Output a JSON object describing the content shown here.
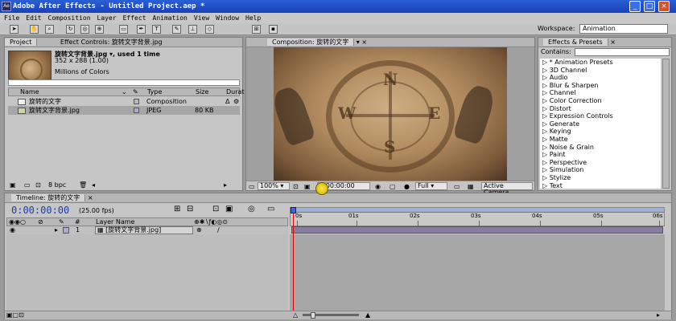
{
  "window": {
    "title": "Adobe After Effects - Untitled Project.aep *"
  },
  "menu": [
    "File",
    "Edit",
    "Composition",
    "Layer",
    "Effect",
    "Animation",
    "View",
    "Window",
    "Help"
  ],
  "toolbar": {
    "workspace_label": "Workspace:",
    "workspace_value": "Animation"
  },
  "project_panel": {
    "tabs": [
      "Project",
      "Effect Controls: 旋转文字背景.jpg"
    ],
    "selected_name": "旋转文字背景.jpg ▾, used 1 time",
    "dimensions": "352 x 288 (1.00)",
    "colors": "Millions of Colors",
    "columns": [
      "Name",
      "Type",
      "Size",
      "Durat"
    ],
    "rows": [
      {
        "name": "旋转的文字",
        "type": "Composition",
        "size": "",
        "dur": "Δ"
      },
      {
        "name": "旋转文字背景.jpg",
        "type": "JPEG",
        "size": "80 KB",
        "dur": ""
      }
    ],
    "bpc": "8 bpc"
  },
  "comp_panel": {
    "tab": "Composition: 旋转的文字",
    "zoom": "100%",
    "timecode": "0:00:00:00",
    "resolution": "Full",
    "camera": "Active Camera",
    "compass_letters": {
      "n": "N",
      "s": "S",
      "e": "E",
      "w": "W"
    }
  },
  "effects_panel": {
    "tab": "Effects & Presets",
    "contains_label": "Contains:",
    "items": [
      "▷ * Animation Presets",
      "▷ 3D Channel",
      "▷ Audio",
      "▷ Blur & Sharpen",
      "▷ Channel",
      "▷ Color Correction",
      "▷ Distort",
      "▷ Expression Controls",
      "▷ Generate",
      "▷ Keying",
      "▷ Matte",
      "▷ Noise & Grain",
      "▷ Paint",
      "▷ Perspective",
      "▷ Simulation",
      "▷ Stylize",
      "▷ Text"
    ]
  },
  "timeline": {
    "tab": "Timeline: 旋转的文字",
    "timecode": "0:00:00:00",
    "fps": "(25.00 fps)",
    "col_num": "#",
    "col_layer": "Layer Name",
    "layer_index": "1",
    "layer_name": "[旋转文字背景.jpg]",
    "ruler": [
      "0s",
      "01s",
      "02s",
      "03s",
      "04s",
      "05s",
      "06s"
    ]
  }
}
